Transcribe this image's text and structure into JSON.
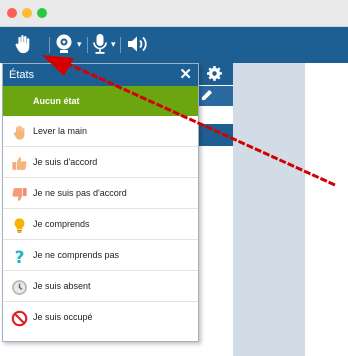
{
  "window": {
    "dots": [
      "#ff5f57",
      "#febc2e",
      "#28c840"
    ]
  },
  "toolbar": {
    "hand_icon": "hand-icon",
    "webcam_icon": "webcam-icon",
    "mic_icon": "microphone-icon",
    "speaker_icon": "speaker-icon",
    "caret": "▾"
  },
  "panel": {
    "title": "États",
    "close": "✕",
    "selected": "Aucun état",
    "items": [
      {
        "label": "Lever la main",
        "icon": "raise-hand-icon"
      },
      {
        "label": "Je suis d'accord",
        "icon": "thumbs-up-icon"
      },
      {
        "label": "Je ne suis pas d'accord",
        "icon": "thumbs-down-icon"
      },
      {
        "label": "Je comprends",
        "icon": "lightbulb-icon"
      },
      {
        "label": "Je ne comprends pas",
        "icon": "question-icon"
      },
      {
        "label": "Je suis absent",
        "icon": "clock-icon"
      },
      {
        "label": "Je suis occupé",
        "icon": "no-entry-icon"
      }
    ]
  },
  "colors": {
    "accent": "#1e5f93",
    "selected": "#6ba50f",
    "arrow": "#d40000"
  }
}
